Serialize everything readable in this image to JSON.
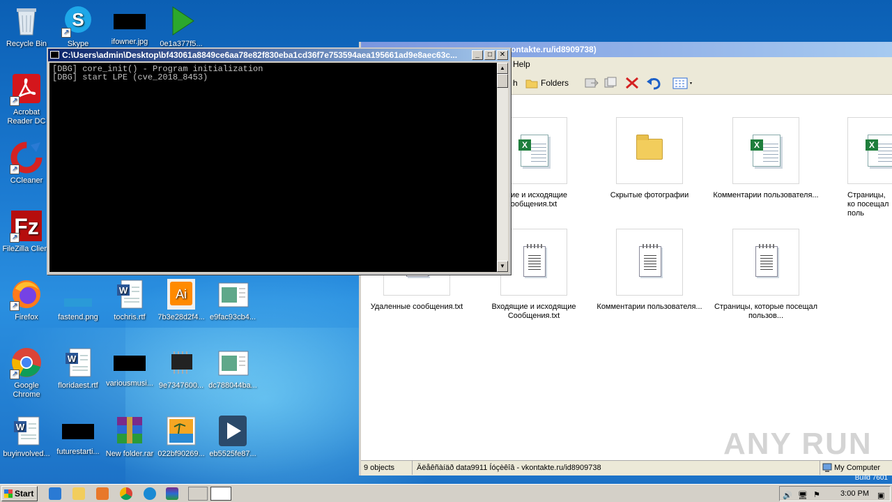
{
  "desktop": {
    "icons": [
      {
        "label": "Recycle Bin",
        "icon": "recycle-bin-icon"
      },
      {
        "label": "Skype",
        "icon": "skype-icon"
      },
      {
        "label": "ifowner.jpg",
        "icon": "image-file-icon"
      },
      {
        "label": "0e1a377f5...",
        "icon": "media-play-icon"
      },
      {
        "label": "Acrobat Reader DC",
        "icon": "acrobat-icon"
      },
      {
        "label": "CCleaner",
        "icon": "ccleaner-icon"
      },
      {
        "label": "FileZilla Client",
        "icon": "filezilla-icon"
      },
      {
        "label": "Firefox",
        "icon": "firefox-icon"
      },
      {
        "label": "fastend.png",
        "icon": "image-file-icon"
      },
      {
        "label": "tochris.rtf",
        "icon": "word-doc-icon"
      },
      {
        "label": "7b3e28d2f4...",
        "icon": "illustrator-icon"
      },
      {
        "label": "e9fac93cb4...",
        "icon": "window-file-icon"
      },
      {
        "label": "Google Chrome",
        "icon": "chrome-icon"
      },
      {
        "label": "floridaest.rtf",
        "icon": "word-doc-icon"
      },
      {
        "label": "variousmusi...",
        "icon": "image-file-icon"
      },
      {
        "label": "9e7347600...",
        "icon": "chip-icon"
      },
      {
        "label": "dc788044ba...",
        "icon": "window-file-icon"
      },
      {
        "label": "buyinvolved...",
        "icon": "word-doc-icon"
      },
      {
        "label": "futurestarti...",
        "icon": "image-file-icon"
      },
      {
        "label": "New folder.rar",
        "icon": "winrar-icon"
      },
      {
        "label": "022bf90269...",
        "icon": "photo-icon"
      },
      {
        "label": "eb5525fe87...",
        "icon": "media-player-icon"
      }
    ]
  },
  "console": {
    "title": "C:\\Users\\admin\\Desktop\\bf43061a8849ce6aa78e82f830eba1cd36f7e753594aea195661ad9e8aec63c...",
    "lines": [
      "[DBG] core_init() - Program initialization",
      "[DBG] start LPE (cve_2018_8453)"
    ]
  },
  "explorer": {
    "title": "ontakte.ru/id8909738)",
    "menu_help": "Help",
    "toolbar": {
      "partial": "h",
      "folders": "Folders"
    },
    "files": [
      {
        "name": "ящие и исходящие ообщения.txt",
        "icon": "excel-icon"
      },
      {
        "name": "Скрытые фотографии",
        "icon": "folder-icon"
      },
      {
        "name": "Комментарии пользователя...",
        "icon": "excel-icon"
      },
      {
        "name": "Страницы, ко посещал поль",
        "icon": "excel-icon"
      },
      {
        "name": "Удаленные сообщения.txt",
        "icon": "text-file-icon"
      },
      {
        "name": "Входящие и исходящие Сообщения.txt",
        "icon": "text-file-icon"
      },
      {
        "name": "Комментарии пользователя...",
        "icon": "text-file-icon"
      },
      {
        "name": "Страницы, которые посещал пользов...",
        "icon": "text-file-icon"
      }
    ],
    "status": {
      "count": "9 objects",
      "path": "Äëåêñàíäð data9911 Íóçèêîâ - vkontakte.ru/id8909738",
      "location": "My Computer"
    }
  },
  "watermark": "ANY RUN",
  "build": "Build 7601",
  "taskbar": {
    "start_label": "Start",
    "clock": "3:00 PM"
  }
}
